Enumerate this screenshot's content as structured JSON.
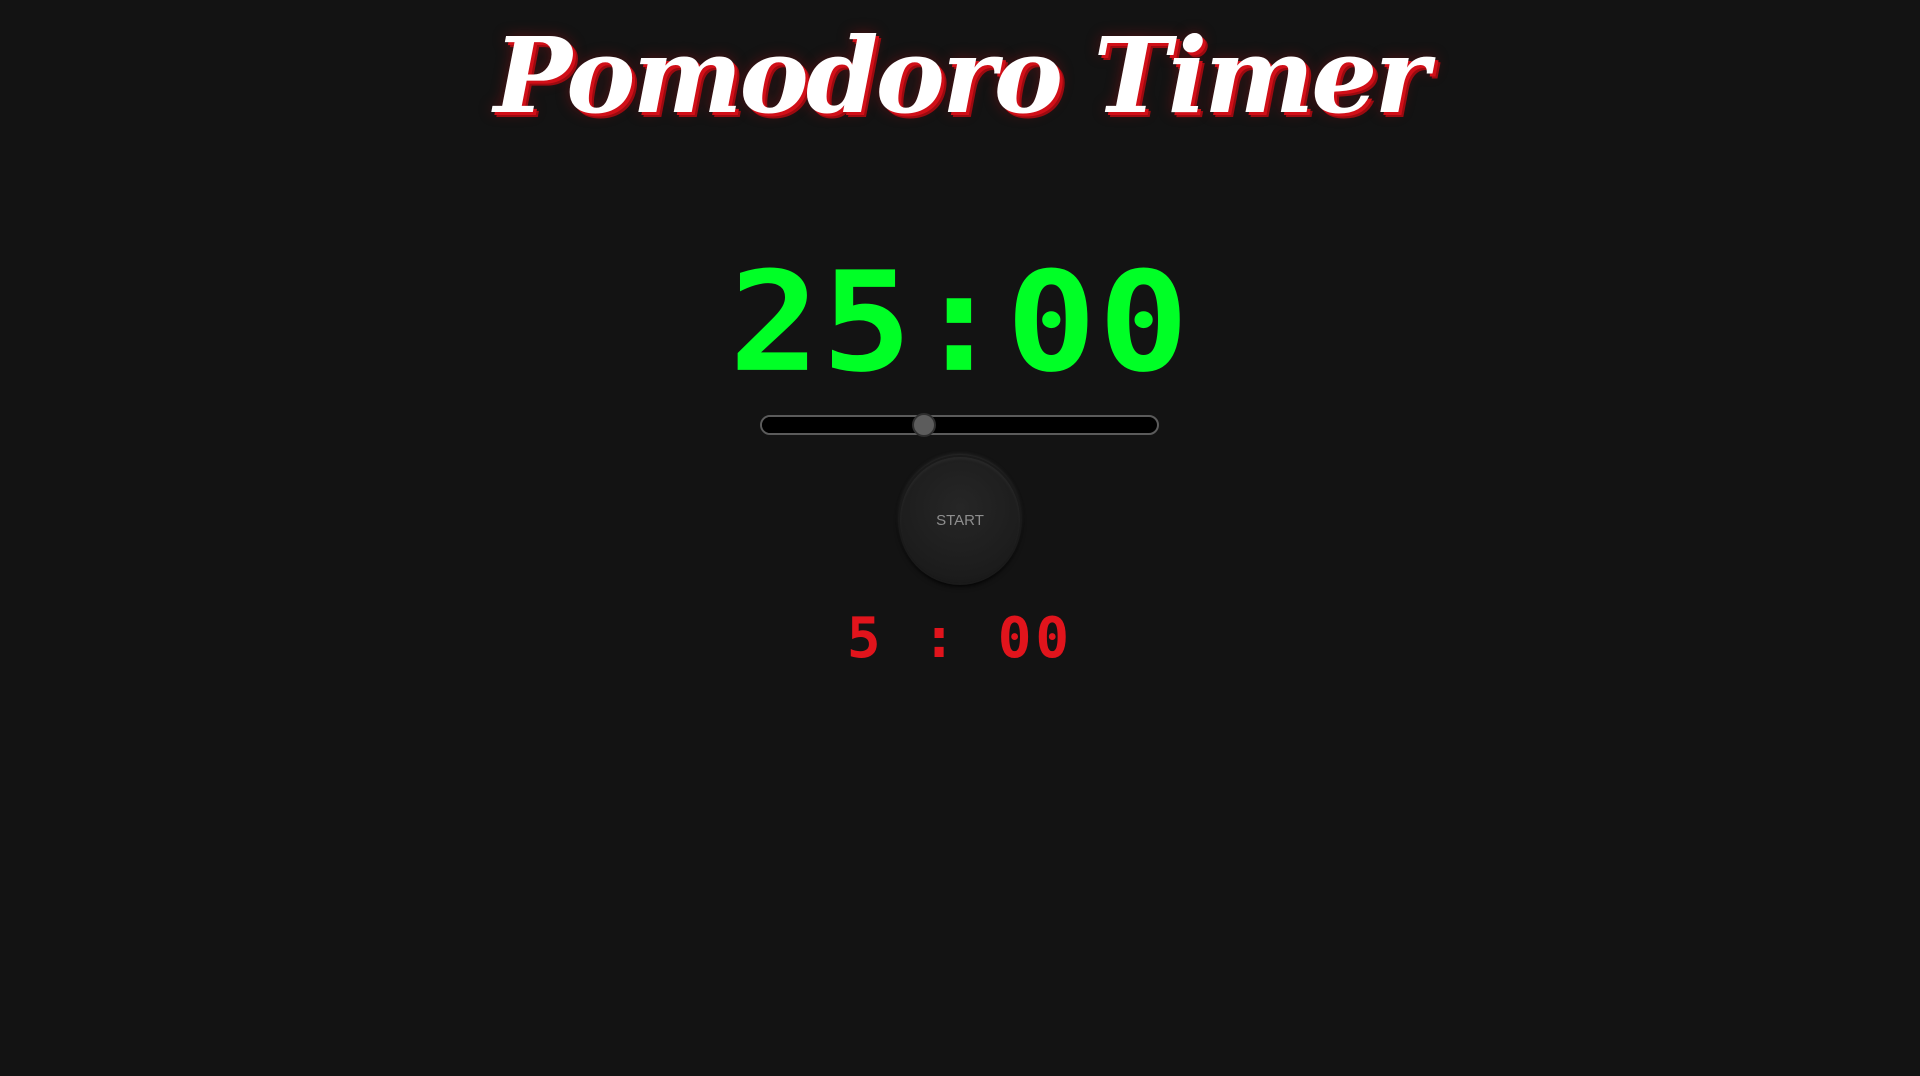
{
  "app": {
    "title": "Pomodoro Timer"
  },
  "timer": {
    "main_time": "25:00",
    "break_time": "5 : 00"
  },
  "slider": {
    "value_fraction": 0.41
  },
  "controls": {
    "start_label": "START"
  },
  "colors": {
    "background": "#131313",
    "main_time": "#00ff26",
    "break_time": "#e1141c",
    "title": "#ffffff",
    "title_shadow": "#d10f18"
  }
}
